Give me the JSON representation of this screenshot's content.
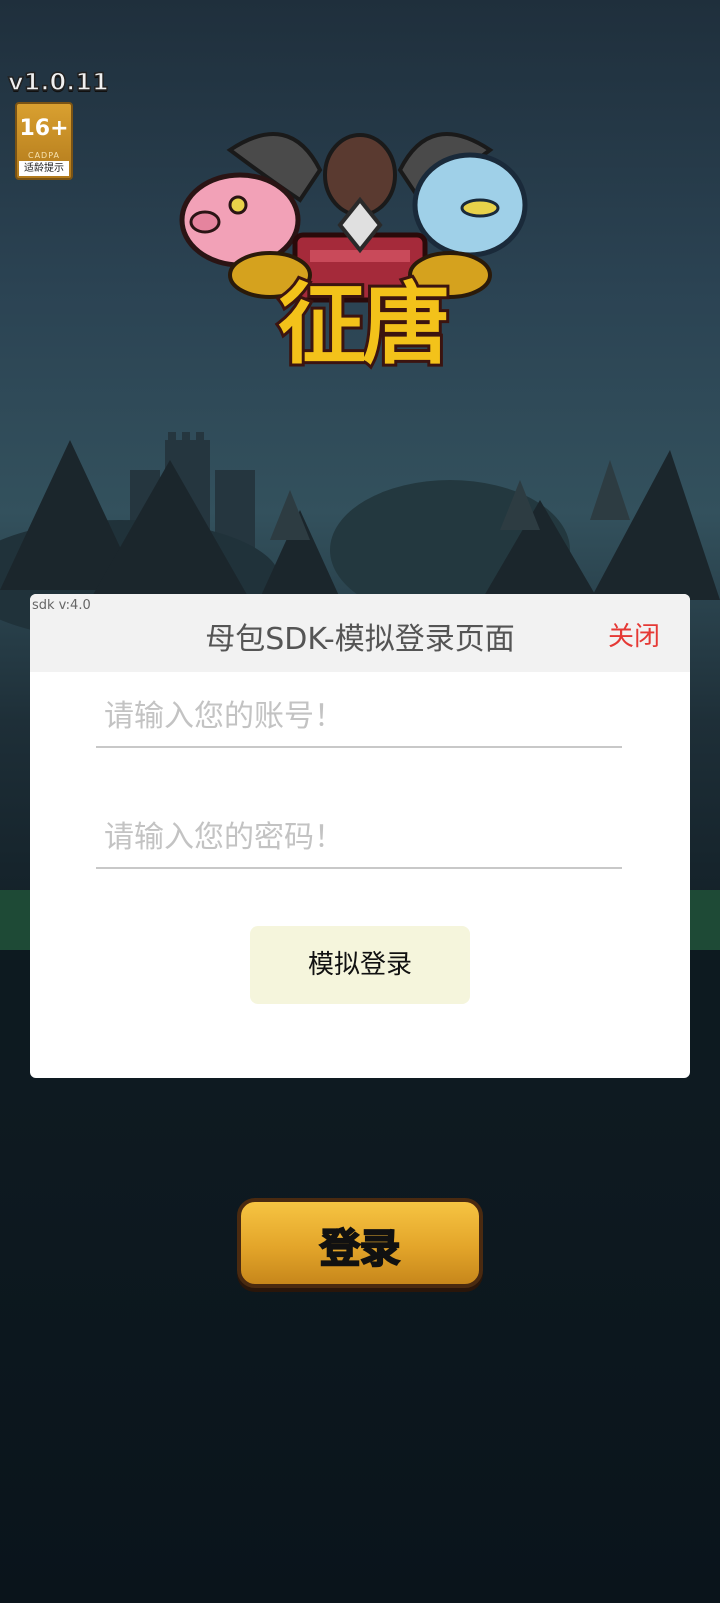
{
  "app": {
    "version": "v1.0.11",
    "age_rating": "16+",
    "age_rating_sub": "CADPA",
    "age_rating_note": "适龄提示",
    "logo_text": "征唐"
  },
  "sdk_dialog": {
    "sdk_version": "sdk v:4.0",
    "title": "母包SDK-模拟登录页面",
    "close_label": "关闭",
    "account_placeholder": "请输入您的账号！",
    "password_placeholder": "请输入您的密码！",
    "submit_label": "模拟登录"
  },
  "game": {
    "login_label": "登录"
  },
  "colors": {
    "close": "#e53935",
    "submit_bg": "#f5f5dc",
    "game_button": "#e3a52a"
  }
}
